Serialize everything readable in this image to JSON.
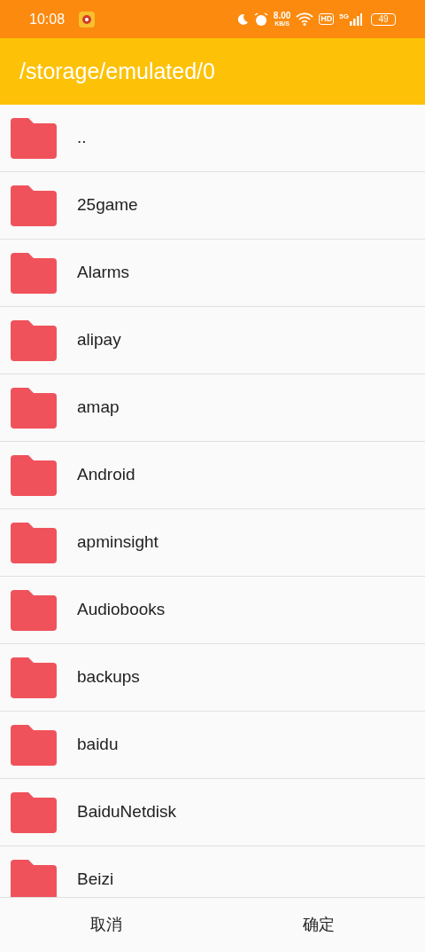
{
  "status_bar": {
    "time": "10:08",
    "speed_value": "8.00",
    "speed_unit": "KB/S",
    "hd": "HD",
    "network": "5G",
    "battery": "49"
  },
  "header": {
    "title": "/storage/emulated/0"
  },
  "files": [
    {
      "name": "..",
      "kind": "folder"
    },
    {
      "name": "25game",
      "kind": "folder"
    },
    {
      "name": "Alarms",
      "kind": "folder"
    },
    {
      "name": "alipay",
      "kind": "folder"
    },
    {
      "name": "amap",
      "kind": "folder"
    },
    {
      "name": "Android",
      "kind": "folder"
    },
    {
      "name": "apminsight",
      "kind": "folder"
    },
    {
      "name": "Audiobooks",
      "kind": "folder"
    },
    {
      "name": "backups",
      "kind": "folder"
    },
    {
      "name": "baidu",
      "kind": "folder"
    },
    {
      "name": "BaiduNetdisk",
      "kind": "folder"
    },
    {
      "name": "Beizi",
      "kind": "folder"
    }
  ],
  "buttons": [
    "取消",
    "确定"
  ]
}
